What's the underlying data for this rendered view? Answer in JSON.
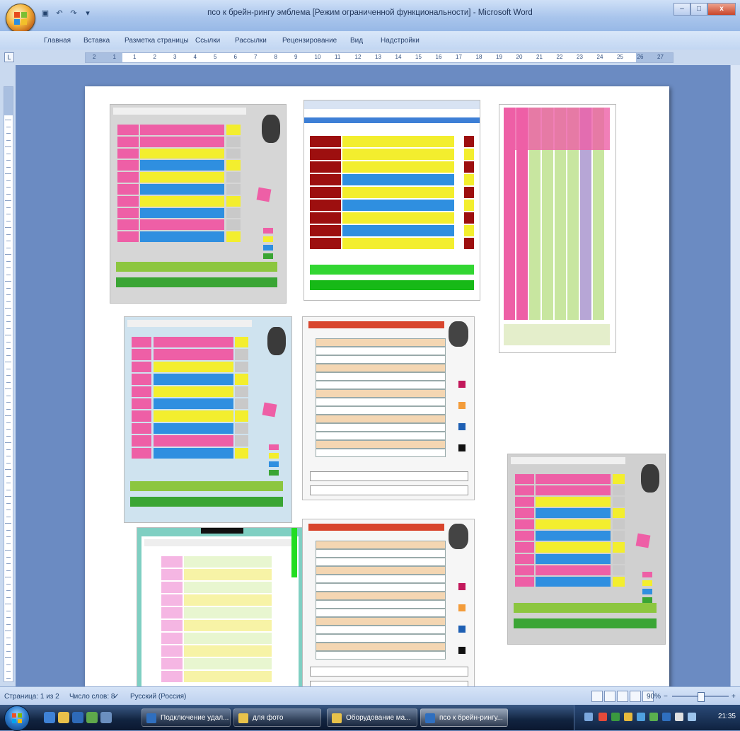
{
  "window": {
    "title": "псо к брейн-рингу эмблема [Режим ограниченной функциональности] - Microsoft Word",
    "controls": {
      "minimize": "–",
      "maximize": "□",
      "close": "x"
    }
  },
  "quick_access": {
    "save_icon": "▣",
    "undo_icon": "↶",
    "redo_icon": "↷",
    "more_icon": "▾"
  },
  "ribbon": {
    "tabs": [
      "Главная",
      "Вставка",
      "Разметка страницы",
      "Ссылки",
      "Рассылки",
      "Рецензирование",
      "Вид",
      "Надстройки"
    ]
  },
  "ruler": {
    "corner": "L",
    "numbers": [
      "2",
      "1",
      "1",
      "2",
      "3",
      "4",
      "5",
      "6",
      "7",
      "8",
      "9",
      "10",
      "11",
      "12",
      "13",
      "14",
      "15",
      "16",
      "17",
      "18",
      "19",
      "20",
      "21",
      "22",
      "23",
      "24",
      "25",
      "26",
      "27"
    ]
  },
  "page_thumbnails": [
    {
      "kind": "table",
      "title": "ПЕРИОДИЧЕСКАЯ СИСТЕМА ХИМИЧЕСКИХ ЭЛЕМЕНТОВ Д.И.МЕНДЕЛЕЕВА"
    },
    {
      "kind": "web",
      "title": ""
    },
    {
      "kind": "long",
      "title": ""
    },
    {
      "kind": "table",
      "title": "ПЕРИОДИЧЕСКАЯ СИСТЕМА ХИМИЧЕСКИХ ЭЛЕМЕНТОВ Д.И.МЕНДЕЛЕЕВА"
    },
    {
      "kind": "long-table",
      "title": "ПЕРИОДИЧЕСКАЯ СИСТЕМА ХИМИЧЕСКИХ ЭЛЕМЕНТОВ Д.И.МЕНДЕЛЕЕВА"
    },
    {
      "kind": "table",
      "title": "ПЕРИОДИЧЕСКАЯ СИСТЕМА ХИМИЧЕСКИХ ЭЛЕМЕНТОВ Д.И.МЕНДЕЛЕЕВА"
    },
    {
      "kind": "light",
      "title": "ПЕРИОДИЧЕСКАЯ СИСТЕМА ХИМИЧЕСКИХ ЭЛЕМЕНТОВ Д.И.МЕНДЕЛЕЕВА"
    },
    {
      "kind": "long-table",
      "title": "ПЕРИОДИЧЕСКАЯ СИСТЕМА ХИМИЧЕСКИХ ЭЛЕМЕНТОВ Д.И.МЕНДЕЛЕЕВА"
    }
  ],
  "status": {
    "page": "Страница: 1 из 2",
    "words": "Число слов: 8",
    "language": "Русский (Россия)",
    "zoom": "90%"
  },
  "taskbar": {
    "buttons": [
      {
        "label": "Подключение удал...",
        "icon_color": "#2f6fbf"
      },
      {
        "label": "для фото",
        "icon_color": "#e8c24a"
      },
      {
        "label": "Оборудование ма...",
        "icon_color": "#e8c24a"
      },
      {
        "label": "псо к брейн-рингу...",
        "icon_color": "#2f6fbf"
      }
    ],
    "clock": "21:35"
  },
  "colors": {
    "pink": "#ee5fa6",
    "yellow": "#f3ee2e",
    "blue": "#2f8fe0",
    "green": "#3aa534",
    "gray": "#c9c9c9",
    "red": "#9d0f0f"
  }
}
